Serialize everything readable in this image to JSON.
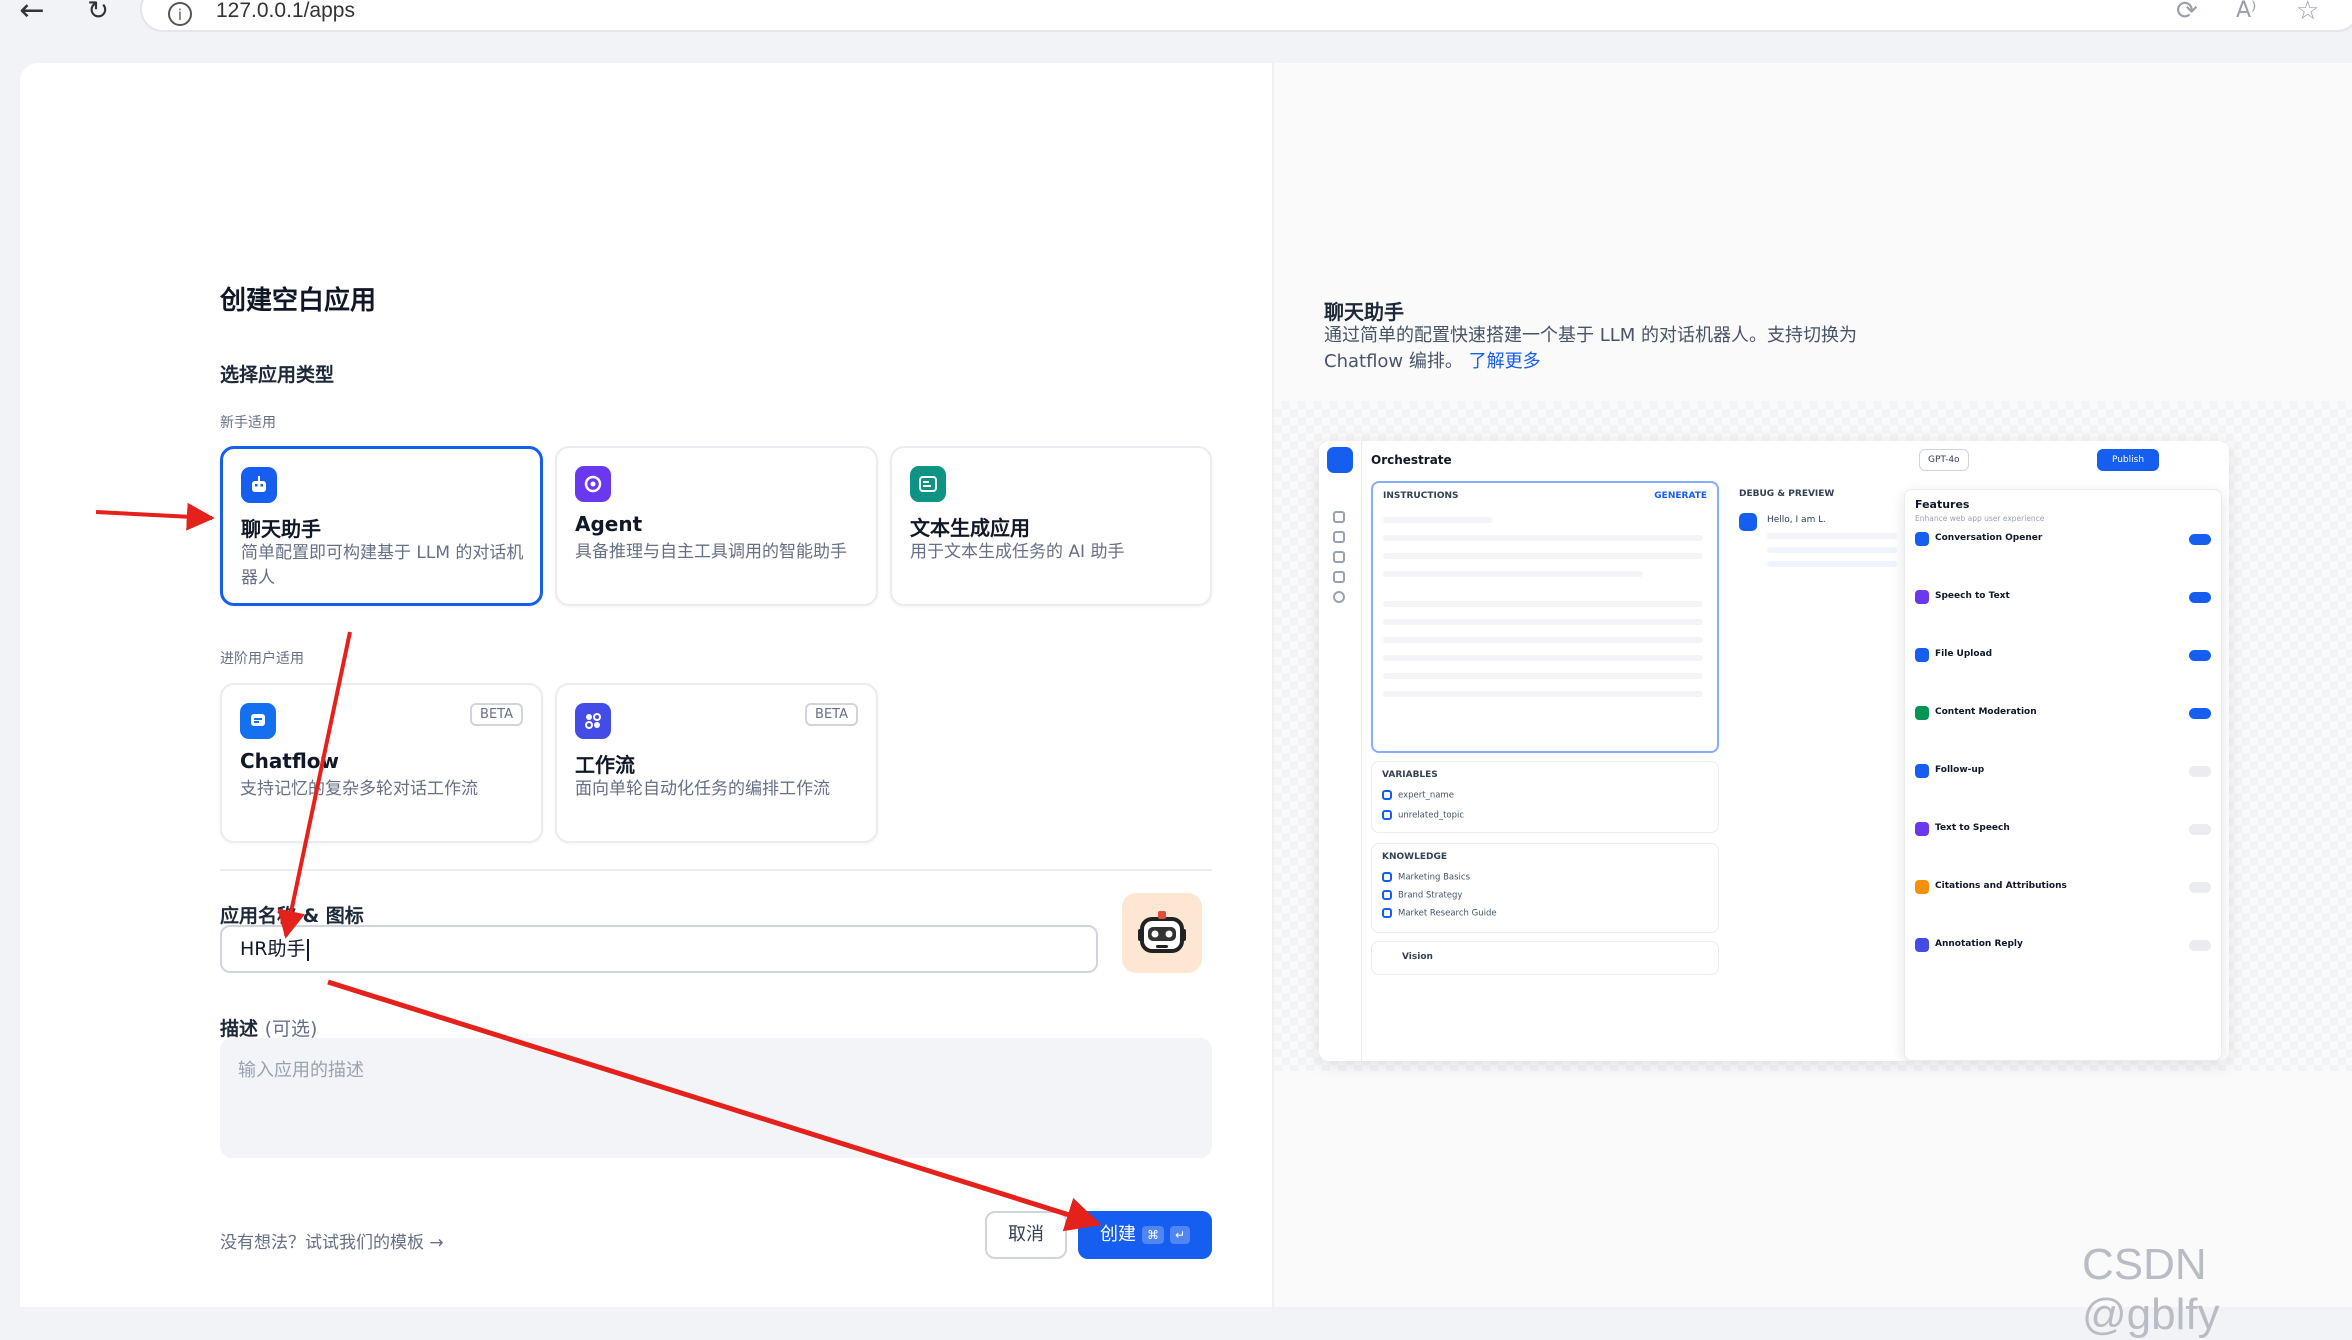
{
  "browser": {
    "url": "127.0.0.1/apps",
    "back_icon": "back-arrow-icon",
    "reload_icon": "reload-icon"
  },
  "form": {
    "page_title": "创建空白应用",
    "section_type": "选择应用类型",
    "group_beginner": "新手适用",
    "group_advanced": "进阶用户适用",
    "types": [
      {
        "name": "聊天助手",
        "desc": "简单配置即可构建基于 LLM 的对话机器人",
        "icon": "chat-bot-icon",
        "color": "#155eef"
      },
      {
        "name": "Agent",
        "desc": "具备推理与自主工具调用的智能助手",
        "icon": "agent-icon",
        "color": "#6938ef"
      },
      {
        "name": "文本生成应用",
        "desc": "用于文本生成任务的 AI 助手",
        "icon": "text-gen-icon",
        "color": "#0e9384"
      },
      {
        "name": "Chatflow",
        "desc": "支持记忆的复杂多轮对话工作流",
        "icon": "chatflow-icon",
        "color": "#1570ef",
        "badge": "BETA"
      },
      {
        "name": "工作流",
        "desc": "面向单轮自动化任务的编排工作流",
        "icon": "workflow-icon",
        "color": "#444ce7",
        "badge": "BETA"
      }
    ],
    "name_label": "应用名称 & 图标",
    "name_value": "HR助手",
    "desc_label": "描述",
    "desc_optional": "(可选)",
    "desc_placeholder": "输入应用的描述",
    "template_link": "没有想法？试试我们的模板",
    "cancel": "取消",
    "create": "创建",
    "create_kbd1": "⌘",
    "create_kbd2": "↵"
  },
  "preview": {
    "title": "聊天助手",
    "desc": "通过简单的配置快速搭建一个基于 LLM 的对话机器人。支持切换为 Chatflow 编排。",
    "link": "了解更多",
    "mock": {
      "header": "Orchestrate",
      "model": "GPT-4o",
      "publish": "Publish",
      "instructions": "INSTRUCTIONS",
      "generate": "GENERATE",
      "variables": "VARIABLES",
      "knowledge": "KNOWLEDGE",
      "vision": "Vision",
      "debug": "DEBUG & PREVIEW",
      "hello": "Hello, I am L.",
      "features": "Features",
      "features_sub": "Enhance web app user experience",
      "variable_rows": [
        "expert_name",
        "unrelated_topic"
      ],
      "knowledge_rows": [
        "Marketing Basics",
        "Brand Strategy",
        "Market Research Guide"
      ],
      "feature_items": [
        "Conversation Opener",
        "Speech to Text",
        "File Upload",
        "Content Moderation",
        "Follow-up",
        "Text to Speech",
        "Citations and Attributions",
        "Annotation Reply"
      ]
    }
  },
  "watermark": "CSDN @gblfy"
}
